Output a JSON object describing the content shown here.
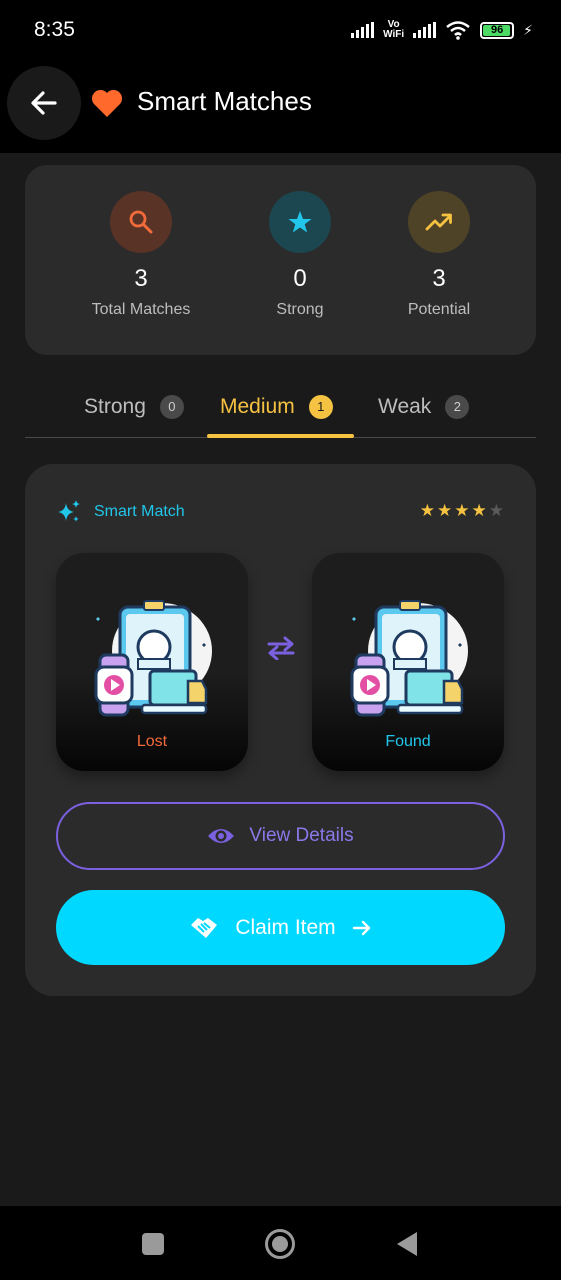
{
  "status_bar": {
    "time": "8:35",
    "network": "Vo WiFi",
    "battery": "96"
  },
  "header": {
    "title": "Smart Matches",
    "back_icon": "back-arrow-icon",
    "title_icon": "heart-icon"
  },
  "stats": [
    {
      "value": "3",
      "label": "Total Matches",
      "icon": "search-icon",
      "color": "#f26b3a"
    },
    {
      "value": "0",
      "label": "Strong",
      "icon": "star-icon",
      "color": "#21c6ea"
    },
    {
      "value": "3",
      "label": "Potential",
      "icon": "trending-up-icon",
      "color": "#f5c242"
    }
  ],
  "tabs": [
    {
      "label": "Strong",
      "count": "0",
      "active": false
    },
    {
      "label": "Medium",
      "count": "1",
      "active": true
    },
    {
      "label": "Weak",
      "count": "2",
      "active": false
    }
  ],
  "match": {
    "type_label": "Smart Match",
    "rating": 4,
    "rating_max": 5,
    "lost_label": "Lost",
    "found_label": "Found",
    "view_label": "View Details",
    "claim_label": "Claim Item"
  },
  "colors": {
    "accent": "#f5c242",
    "lost": "#f26b3a",
    "found": "#21c6ea",
    "purple": "#7b61e0",
    "claim": "#00d8ff"
  }
}
